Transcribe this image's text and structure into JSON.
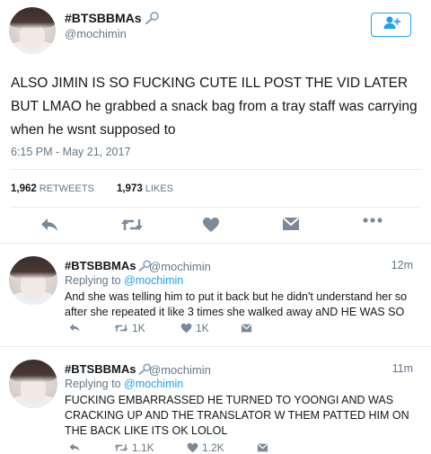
{
  "main_tweet": {
    "display_name": "#BTSBBMAs",
    "handle": "@mochimin",
    "text": "ALSO JIMIN IS SO FUCKING CUTE ILL POST THE VID LATER BUT LMAO he grabbed a snack bag from a tray staff was carrying when he wsnt supposed to",
    "timestamp": "6:15 PM - May 21, 2017",
    "retweets_count": "1,962",
    "retweets_label": "Retweets",
    "likes_count": "1,973",
    "likes_label": "Likes",
    "icons": [
      "reply-icon",
      "retweet-icon",
      "heart-icon",
      "message-icon",
      "more-icon",
      "follow-icon",
      "verified-icon"
    ]
  },
  "replies": [
    {
      "display_name": "#BTSBBMAs",
      "handle": "@mochimin",
      "time": "12m",
      "replying_prefix": "Replying to",
      "replying_to": "@mochimin",
      "text": "And she was telling him to put it back but he didn't understand her so after she repeated it like 3 times she walked away aND HE WAS SO",
      "retweets": "1K",
      "likes": "1K"
    },
    {
      "display_name": "#BTSBBMAs",
      "handle": "@mochimin",
      "time": "11m",
      "replying_prefix": "Replying to",
      "replying_to": "@mochimin",
      "text": "FUCKING EMBARRASSED HE TURNED TO YOONGI AND WAS CRACKING UP AND THE TRANSLATOR W THEM PATTED HIM ON THE BACK LIKE ITS OK LOLOL",
      "retweets": "1.1K",
      "likes": "1.2K"
    }
  ],
  "colors": {
    "accent": "#1da1f2",
    "text": "#14171a",
    "muted": "#657786",
    "icon": "#7a8a99",
    "divider": "#e6ecf0"
  }
}
